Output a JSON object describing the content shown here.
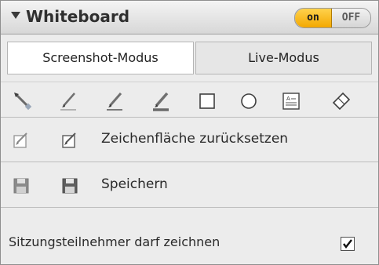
{
  "header": {
    "title": "Whiteboard",
    "toggle_on": "on",
    "toggle_off": "OFF",
    "toggle_state": "on"
  },
  "tabs": [
    {
      "label": "Screenshot-Modus",
      "active": true
    },
    {
      "label": "Live-Modus",
      "active": false
    }
  ],
  "tools": [
    {
      "icon": "pointer-pen-icon"
    },
    {
      "icon": "pencil-thin-icon"
    },
    {
      "icon": "pencil-medium-icon"
    },
    {
      "icon": "pencil-thick-icon"
    },
    {
      "icon": "rectangle-icon"
    },
    {
      "icon": "ellipse-icon"
    },
    {
      "icon": "text-box-icon"
    },
    {
      "icon": "eraser-icon"
    }
  ],
  "rows": {
    "reset": {
      "label": "Zeichenfläche zurücksetzen",
      "icons": [
        "reset-canvas-icon-disabled",
        "reset-canvas-icon"
      ]
    },
    "save": {
      "label": "Speichern",
      "icons": [
        "save-icon-disabled",
        "save-icon"
      ]
    }
  },
  "permission": {
    "label": "Sitzungsteilnehmer darf zeichnen",
    "checked": true
  },
  "colors": {
    "toggle_accent": "#f3a800",
    "panel_bg": "#ececec"
  }
}
